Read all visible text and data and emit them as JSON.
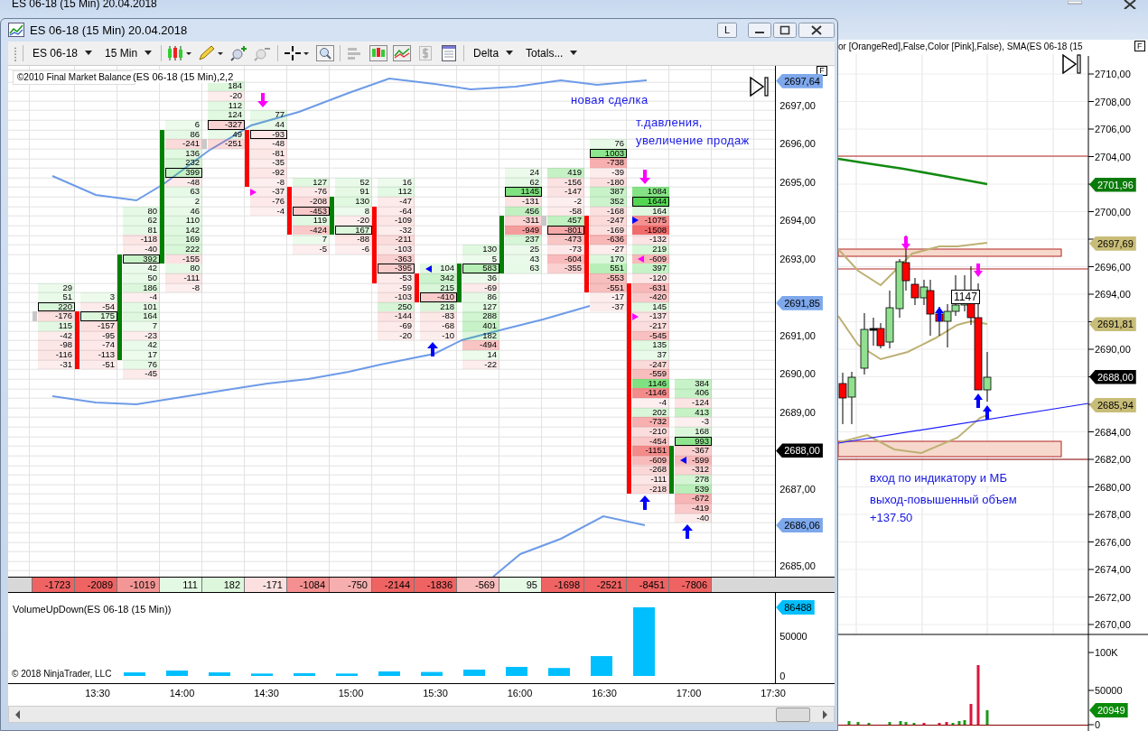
{
  "background_window": {
    "title": "ES 06-18 (15 Min)  20.04.2018",
    "legend": "or [OrangeRed],False,Color [Pink],False), SMA(ES 06-18 (15",
    "panel_button": "F",
    "price_axis": [
      "2710,00",
      "2708,00",
      "2706,00",
      "2704,00",
      "2700,00",
      "2696,00",
      "2694,00",
      "2690,00",
      "2684,00",
      "2682,00",
      "2680,00",
      "2678,00",
      "2676,00",
      "2674,00",
      "2672,00",
      "2670,00"
    ],
    "price_tags": [
      {
        "value": "2701,96",
        "color": "#0a7a0a"
      },
      {
        "value": "2697,69",
        "color": "#c8bd78"
      },
      {
        "value": "2691,81",
        "color": "#c8bd78"
      },
      {
        "value": "2688,00",
        "color": "#000000"
      },
      {
        "value": "2685,94",
        "color": "#c8bd78"
      }
    ],
    "bar_label": "1147",
    "notes": [
      "вход по индикатору и МБ",
      "выход-повышенный объем",
      "+137.50"
    ],
    "volume_axis": [
      "100K",
      "50000",
      "0"
    ],
    "volume_tag": "20949"
  },
  "front_window": {
    "title": "ES 06-18 (15 Min)  20.04.2018",
    "extra_button": "L",
    "toolbar": {
      "instrument": "ES 06-18",
      "interval": "15 Min",
      "chart_style": "Delta",
      "totals": "Totals..."
    },
    "legend": {
      "indicator": "©2010 Final Market Balance",
      "params": "(ES 06-18 (15 Min),2,2"
    },
    "panel_button": "F",
    "annotations": [
      "новая сделка",
      "т.давления,",
      "увеличение продаж"
    ],
    "price_axis": [
      "2697,00",
      "2696,00",
      "2695,00",
      "2694,00",
      "2693,00",
      "2691,00",
      "2690,00",
      "2689,00",
      "2687,00",
      "2685,00"
    ],
    "price_tags": [
      {
        "value": "2697,64",
        "color": "#7ea8ec"
      },
      {
        "value": "2691,85",
        "color": "#7ea8ec"
      },
      {
        "value": "2688,00",
        "color": "#000000"
      },
      {
        "value": "2686,06",
        "color": "#7ea8ec"
      }
    ],
    "bars": [
      {
        "color": "#c8c8c8",
        "total": "-1723",
        "upper_cells": [
          null,
          null,
          null,
          null,
          null,
          null,
          null,
          null,
          null,
          null,
          null,
          null,
          null,
          null,
          null,
          null,
          null,
          null,
          null,
          null,
          null,
          "29",
          "51",
          {
            "value": "220",
            "boxed": true
          }
        ],
        "body_cells": [
          "-176"
        ],
        "lower_cells": [
          "115",
          "-42",
          "-98",
          "-116",
          "-31"
        ]
      },
      {
        "color": "#ff0000",
        "total": "-2089",
        "upper_cells": [
          null,
          null,
          null,
          null,
          null,
          null,
          null,
          null,
          null,
          null,
          null,
          null,
          null,
          null,
          null,
          null,
          null,
          null,
          null,
          null,
          null,
          null,
          "3",
          "-54"
        ],
        "body_cells": [
          {
            "value": "175",
            "boxed": true
          },
          "-157",
          "-95",
          "-74",
          "-113",
          "-51"
        ]
      },
      {
        "color": "#008000",
        "total": "-1019",
        "upper_cells": [
          null,
          null,
          null,
          null,
          null,
          null,
          null,
          null,
          null,
          null,
          null,
          null,
          null,
          "80",
          "62",
          "81",
          "-118",
          "-40"
        ],
        "body_cells": [
          {
            "value": "392",
            "boxed": true
          },
          "42",
          "50",
          "186",
          "-4",
          "101",
          "164",
          "7",
          "-23",
          "42",
          "17"
        ],
        "lower_cells": [
          "76",
          "-45"
        ]
      },
      {
        "color": "#008000",
        "total": "111",
        "upper_cells": [
          null,
          null,
          null,
          null,
          "6"
        ],
        "body_cells": [
          "86",
          "-241",
          "136",
          "232",
          {
            "value": "399",
            "boxed": true
          },
          "-48",
          "63",
          "2",
          "46",
          "110",
          "142",
          "169",
          "222",
          "-155"
        ],
        "lower_cells": [
          "80",
          "-111",
          "-8"
        ]
      },
      {
        "color": "#c8c8c8",
        "total": "182",
        "upper_cells": [
          "184",
          "-20",
          "112",
          "124",
          {
            "value": "-327",
            "boxed": true
          },
          "49"
        ],
        "body_cells": [
          "-251"
        ]
      },
      {
        "color": "#ff0000",
        "total": "-171",
        "signals": [
          {
            "kind": "down-arrow"
          }
        ],
        "upper_cells": [
          null,
          null,
          null,
          "77",
          "44"
        ],
        "body_cells": [
          {
            "value": "-93",
            "boxed": true
          },
          "-48",
          "-81",
          "-35",
          "-92",
          "-8"
        ],
        "lower_cells": [
          {
            "value": "-37",
            "marker": {
              "kind": "right",
              "color": "#ff00ff"
            }
          },
          "-76",
          "-4"
        ]
      },
      {
        "color": "#ff0000",
        "total": "-1084",
        "upper_cells": [
          null,
          null,
          null,
          null,
          null,
          null,
          null,
          null,
          null,
          null,
          "127"
        ],
        "body_cells": [
          "-76",
          "-208",
          {
            "value": "-453",
            "boxed": true
          },
          "119",
          "-424"
        ],
        "lower_cells": [
          "7",
          "-5"
        ]
      },
      {
        "color": "#008000",
        "total": "-750",
        "upper_cells": [
          null,
          null,
          null,
          null,
          null,
          null,
          null,
          null,
          null,
          null,
          "52",
          "91"
        ],
        "body_cells": [
          "130",
          "8",
          "-20",
          {
            "value": "167",
            "boxed": true
          }
        ],
        "lower_cells": [
          "-88",
          "-6"
        ]
      },
      {
        "color": "#ff0000",
        "total": "-2144",
        "upper_cells": [
          null,
          null,
          null,
          null,
          null,
          null,
          null,
          null,
          null,
          null,
          "16",
          "112",
          "-47"
        ],
        "body_cells": [
          "-64",
          "-109",
          "-32",
          "-211",
          "-103",
          "-363",
          {
            "value": "-395",
            "boxed": true
          },
          "-53"
        ],
        "lower_cells": [
          "-59",
          "-103",
          "250",
          "-144",
          "-69",
          "-20"
        ]
      },
      {
        "color": "#ff0000",
        "total": "-1836",
        "signals": [
          {
            "kind": "up-arrow"
          }
        ],
        "upper_cells": [
          null,
          null,
          null,
          null,
          null,
          null,
          null,
          null,
          null,
          null,
          null,
          null,
          null,
          null,
          null,
          null,
          null,
          null,
          null,
          {
            "value": "104",
            "marker": {
              "kind": "left",
              "color": "#0000ff"
            }
          }
        ],
        "body_cells": [
          "342",
          "215",
          {
            "value": "-410",
            "boxed": true
          }
        ],
        "lower_cells": [
          "218",
          "-83",
          "-68",
          "-10"
        ]
      },
      {
        "color": "#008000",
        "total": "-569",
        "upper_cells": [
          null,
          null,
          null,
          null,
          null,
          null,
          null,
          null,
          null,
          null,
          null,
          null,
          null,
          null,
          null,
          null,
          null,
          "130",
          "5"
        ],
        "body_cells": [
          {
            "value": "583",
            "boxed": true
          },
          "36",
          "-69",
          "86"
        ],
        "lower_cells": [
          "127",
          "288",
          "401",
          "182",
          "-494",
          "14",
          "-22"
        ]
      },
      {
        "color": "#008000",
        "total": "95",
        "upper_cells": [
          null,
          null,
          null,
          null,
          null,
          null,
          null,
          null,
          null,
          "24",
          "62",
          {
            "value": "1145",
            "boxed": true
          },
          "-131",
          "456"
        ],
        "body_cells": [
          "-311",
          "-949",
          "237",
          "25",
          "43",
          "63"
        ]
      },
      {
        "color": "#c8c8c8",
        "total": "-1698",
        "upper_cells": [
          null,
          null,
          null,
          null,
          null,
          null,
          null,
          null,
          null,
          "419",
          "-156",
          "-147",
          "-2",
          "-58"
        ],
        "body_cells": [
          "457"
        ],
        "lower_cells": [
          {
            "value": "-801",
            "boxed": true
          },
          "-473",
          "-73",
          "-604",
          "-355"
        ]
      },
      {
        "color": "#ff0000",
        "total": "-2521",
        "upper_cells": [
          null,
          null,
          null,
          null,
          null,
          null,
          "76",
          {
            "value": "1003",
            "boxed": true
          },
          "-738",
          "-39",
          "-180",
          "387",
          "352",
          "-168"
        ],
        "body_cells": [
          "-247",
          "-169",
          "-636",
          "-27",
          "170",
          "551",
          "-553",
          "-551"
        ],
        "lower_cells": [
          "-17",
          "-37"
        ]
      },
      {
        "color": "#ff0000",
        "total": "-8451",
        "signals": [
          {
            "kind": "down-arrow"
          },
          {
            "kind": "up-arrow"
          }
        ],
        "upper_cells": [
          null,
          null,
          null,
          null,
          null,
          null,
          null,
          null,
          null,
          null,
          null,
          "1084",
          {
            "value": "1644",
            "boxed": true
          },
          "164",
          {
            "value": "-1075",
            "marker": {
              "kind": "right",
              "color": "#0000ff"
            }
          },
          "-1508",
          "-132",
          "219",
          {
            "value": "-609",
            "marker": {
              "kind": "left",
              "color": "#ff00ff"
            }
          },
          "397",
          "-120"
        ],
        "body_cells": [
          "-631",
          "-420",
          "145",
          {
            "value": "-137",
            "marker": {
              "kind": "right",
              "color": "#ff00ff"
            }
          },
          "-217",
          "-545",
          "135",
          "37",
          "-247",
          "-559",
          "1146",
          "-1146",
          "-4",
          "202",
          "-732",
          "-210",
          "-454",
          "-1151",
          "-609",
          "-268",
          "-111",
          "-218"
        ]
      },
      {
        "color": "#008000",
        "total": "-7806",
        "signals": [
          {
            "kind": "up-arrow"
          }
        ],
        "upper_cells": [
          null,
          null,
          null,
          null,
          null,
          null,
          null,
          null,
          null,
          null,
          null,
          null,
          null,
          null,
          null,
          null,
          null,
          null,
          null,
          null,
          null,
          null,
          null,
          null,
          null,
          null,
          null,
          null,
          null,
          null,
          null,
          "384",
          "406",
          "-124",
          "413",
          "-3",
          "168",
          {
            "value": "993",
            "boxed": true
          }
        ],
        "body_cells": [
          "-367",
          {
            "value": "-599",
            "marker": {
              "kind": "left",
              "color": "#0000ff"
            }
          },
          "-312",
          "278",
          "539"
        ],
        "lower_cells": [
          "-672",
          "-419",
          "-40"
        ]
      }
    ],
    "volume": {
      "value_tag": "86488",
      "copyright": "© 2018 NinjaTrader, LLC",
      "title": "VolumeUpDown(ES 06-18 (15 Min))",
      "axis": [
        "50000",
        "0"
      ]
    },
    "time_axis": [
      "13:30",
      "14:00",
      "14:30",
      "15:00",
      "15:30",
      "16:00",
      "16:30",
      "17:00",
      "17:30"
    ]
  }
}
